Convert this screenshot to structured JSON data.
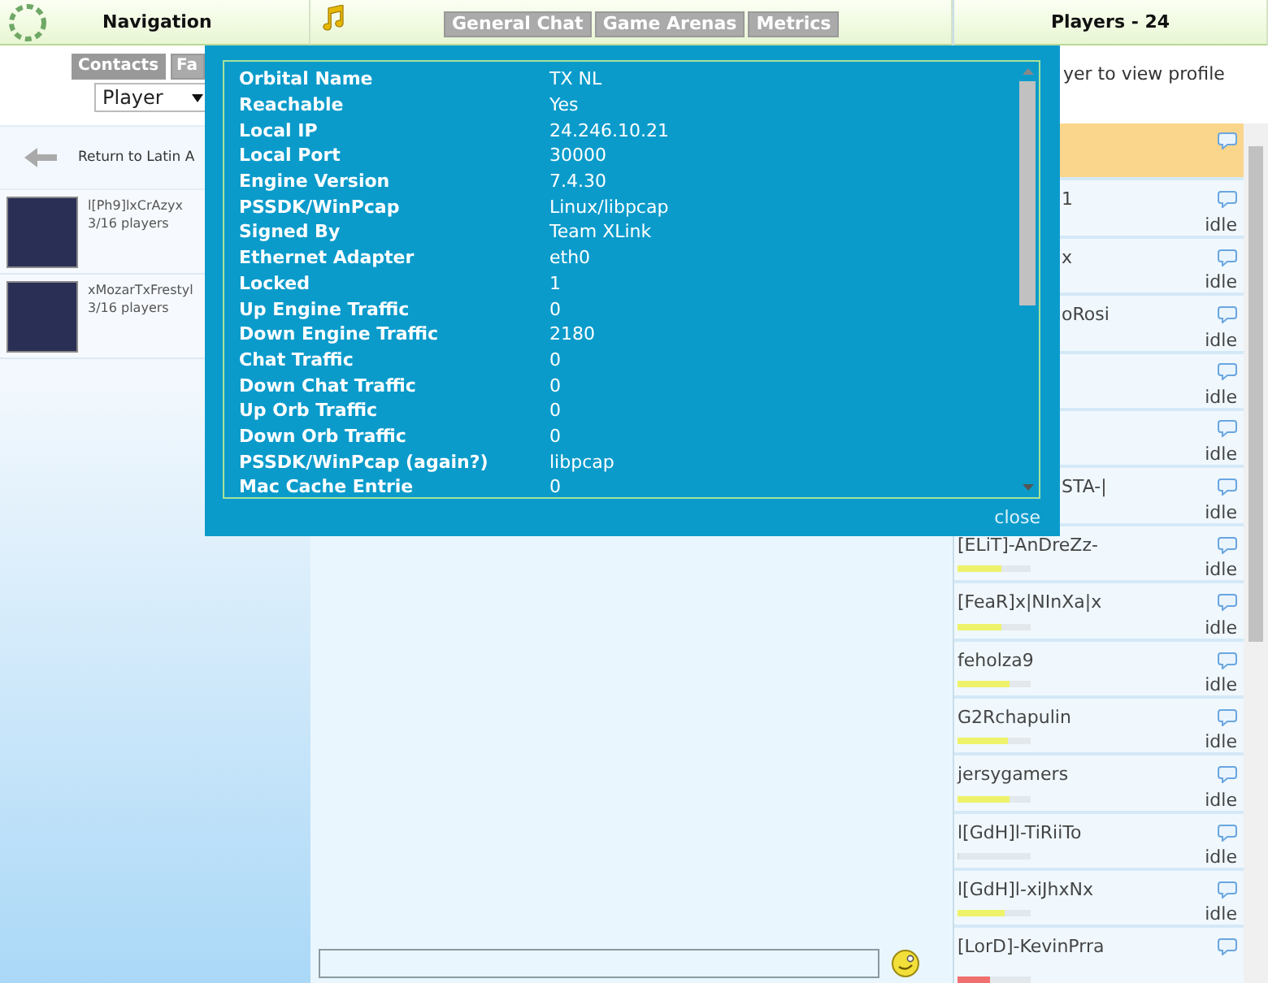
{
  "navigation": {
    "title": "Navigation",
    "tabs": [
      {
        "label": "Contacts",
        "selected": true
      },
      {
        "label": "Fa",
        "selected": false
      }
    ],
    "filter": {
      "value": "Player"
    },
    "back_link": "Return to Latin A",
    "games": [
      {
        "name": "l[Ph9]lxCrAzyx",
        "players": "3/16 players"
      },
      {
        "name": "xMozarTxFrestyl",
        "players": "3/16 players"
      }
    ]
  },
  "chat": {
    "tabs": [
      {
        "label": "General Chat",
        "selected": false
      },
      {
        "label": "Game Arenas",
        "selected": false
      },
      {
        "label": "Metrics",
        "selected": false
      }
    ]
  },
  "players_panel": {
    "title": "Players - 24",
    "hint": "yer to view profile",
    "players": [
      {
        "selected": true,
        "partly_hidden": true
      },
      {
        "name": "1",
        "status": "idle",
        "selected": false,
        "partly_hidden": true
      },
      {
        "name": "x",
        "status": "idle",
        "selected": false,
        "partly_hidden": true
      },
      {
        "name": "oRosi",
        "status": "idle",
        "selected": false,
        "partly_hidden": true
      },
      {
        "status": "idle",
        "selected": false
      },
      {
        "status": "idle",
        "selected": false
      },
      {
        "name": "STA-|",
        "status": "idle",
        "selected": false,
        "partly_hidden": true
      },
      {
        "name": "[ELiT]-AnDreZz-",
        "status": "idle",
        "selected": false,
        "partly_hidden": false,
        "level": 0.6,
        "color": "#eef26a"
      },
      {
        "name": "[FeaR]x|NInXa|x",
        "status": "idle",
        "selected": false,
        "partly_hidden": false,
        "level": 0.6,
        "color": "#eef26a"
      },
      {
        "name": "feholza9",
        "status": "idle",
        "selected": false,
        "partly_hidden": false,
        "level": 0.72,
        "color": "#eef26a"
      },
      {
        "name": "G2Rchapulin",
        "status": "idle",
        "selected": false,
        "partly_hidden": false,
        "level": 0.68,
        "color": "#eef26a"
      },
      {
        "name": "jersygamers",
        "status": "idle",
        "selected": false,
        "partly_hidden": false,
        "level": 0.7,
        "color": "#eef26a"
      },
      {
        "name": "l[GdH]l-TiRiiTo",
        "status": "idle",
        "selected": false,
        "partly_hidden": false,
        "level": 0
      },
      {
        "name": "l[GdH]l-xiJhxNx",
        "status": "idle",
        "selected": false,
        "partly_hidden": false,
        "level": 0.64,
        "color": "#eef26a"
      },
      {
        "name": "[LorD]-KevinPrra",
        "selected": false,
        "partly_hidden": false,
        "level": 0.45,
        "color": "#f07070"
      }
    ]
  },
  "info_dialog": {
    "rows": [
      {
        "label": "Orbital Name",
        "value": "TX NL"
      },
      {
        "label": "Reachable",
        "value": "Yes"
      },
      {
        "label": "Local IP",
        "value": "24.246.10.21"
      },
      {
        "label": "Local Port",
        "value": "30000"
      },
      {
        "label": "Engine Version",
        "value": "7.4.30"
      },
      {
        "label": "PSSDK/WinPcap",
        "value": "Linux/libpcap"
      },
      {
        "label": "Signed By",
        "value": "Team XLink"
      },
      {
        "label": "Ethernet Adapter",
        "value": "eth0"
      },
      {
        "label": "Locked",
        "value": "1"
      },
      {
        "label": "Up Engine Traffic",
        "value": "0"
      },
      {
        "label": "Down Engine Traffic",
        "value": "2180"
      },
      {
        "label": "Chat Traffic",
        "value": "0"
      },
      {
        "label": "Down Chat Traffic",
        "value": "0"
      },
      {
        "label": "Up Orb Traffic",
        "value": "0"
      },
      {
        "label": "Down Orb Traffic",
        "value": "0"
      },
      {
        "label": "PSSDK/WinPcap (again?)",
        "value": "libpcap"
      },
      {
        "label": "Mac Cache Entrie",
        "value": "0"
      }
    ],
    "close": "close"
  }
}
